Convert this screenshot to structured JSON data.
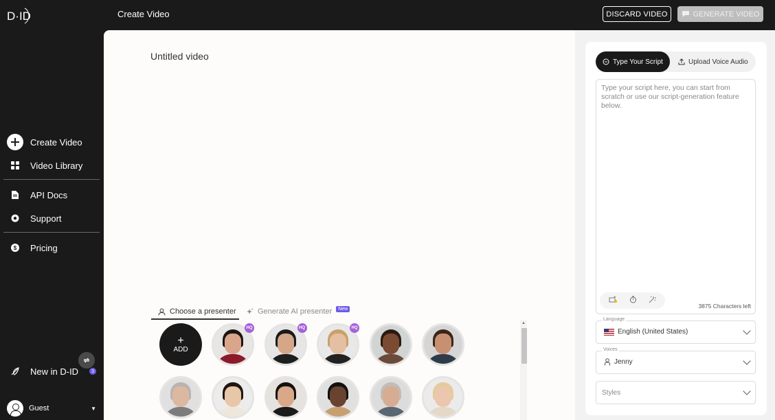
{
  "header": {
    "title": "Create Video",
    "discard_label": "DISCARD VIDEO",
    "generate_label": "GENERATE VIDEO"
  },
  "sidebar": {
    "items": [
      {
        "label": "Create Video",
        "icon": "plus-circle-icon"
      },
      {
        "label": "Video Library",
        "icon": "grid-icon"
      },
      {
        "label": "API Docs",
        "icon": "document-icon"
      },
      {
        "label": "Support",
        "icon": "lifebuoy-icon"
      },
      {
        "label": "Pricing",
        "icon": "dollar-icon"
      }
    ],
    "new_label": "New in D-ID",
    "new_count": "3",
    "user_name": "Guest"
  },
  "main": {
    "video_title": "Untitled video",
    "tabs": {
      "choose": "Choose a presenter",
      "generate": "Generate AI presenter",
      "new_badge": "New"
    },
    "add_label": "ADD",
    "hq_label": "HQ",
    "presenters": [
      {
        "name": "presenter-man-red-suit",
        "hq": true,
        "skin": "#d9a68c",
        "hair": "#1c1512",
        "body": "#8b1a2b",
        "bg": "#e8e6e4"
      },
      {
        "name": "presenter-man-black-suit",
        "hq": true,
        "skin": "#d4a789",
        "hair": "#1a1a1a",
        "body": "#1e1e1e",
        "bg": "#e6e6e6"
      },
      {
        "name": "presenter-woman-blonde",
        "hq": true,
        "skin": "#e5bfa3",
        "hair": "#c8a16a",
        "body": "#222",
        "bg": "#e8e8e8"
      },
      {
        "name": "presenter-woman-curly",
        "hq": false,
        "skin": "#7a4a32",
        "hair": "#2a1a12",
        "body": "#6b4a3a",
        "bg": "#d0d4d2"
      },
      {
        "name": "presenter-man-beard",
        "hq": false,
        "skin": "#c89072",
        "hair": "#3a2518",
        "body": "#2f3b4a",
        "bg": "#d5d5d5"
      },
      {
        "name": "presenter-woman-grey",
        "hq": false,
        "skin": "#dcb8a0",
        "hair": "#b8b4b0",
        "body": "#7c7c7c",
        "bg": "#e0e0e0"
      },
      {
        "name": "presenter-woman-asian",
        "hq": false,
        "skin": "#e8c6a8",
        "hair": "#1e1612",
        "body": "#efe6dc",
        "bg": "#ececec"
      },
      {
        "name": "presenter-woman-dark-hair",
        "hq": false,
        "skin": "#d8a888",
        "hair": "#151010",
        "body": "#1a1a1a",
        "bg": "#e6e2de"
      },
      {
        "name": "presenter-woman-glasses",
        "hq": false,
        "skin": "#6a4230",
        "hair": "#121010",
        "body": "#c8a070",
        "bg": "#e0e0e0"
      },
      {
        "name": "presenter-man-grey",
        "hq": false,
        "skin": "#d6ac92",
        "hair": "#c0bcb8",
        "body": "#5a6672",
        "bg": "#dcdcdc"
      },
      {
        "name": "presenter-woman-light-hair",
        "hq": false,
        "skin": "#ecc6ae",
        "hair": "#e2cc9c",
        "body": "#e6d8c8",
        "bg": "#ebebeb"
      }
    ]
  },
  "panel": {
    "tab_script": "Type Your Script",
    "tab_upload": "Upload Voice Audio",
    "script_placeholder": "Type your script here, you can start from scratch or use our script-generation feature below.",
    "chars_left": "3875 Characters left",
    "language_label": "Language",
    "language_value": "English (United States)",
    "voices_label": "Voices",
    "voices_value": "Jenny",
    "styles_placeholder": "Styles"
  }
}
